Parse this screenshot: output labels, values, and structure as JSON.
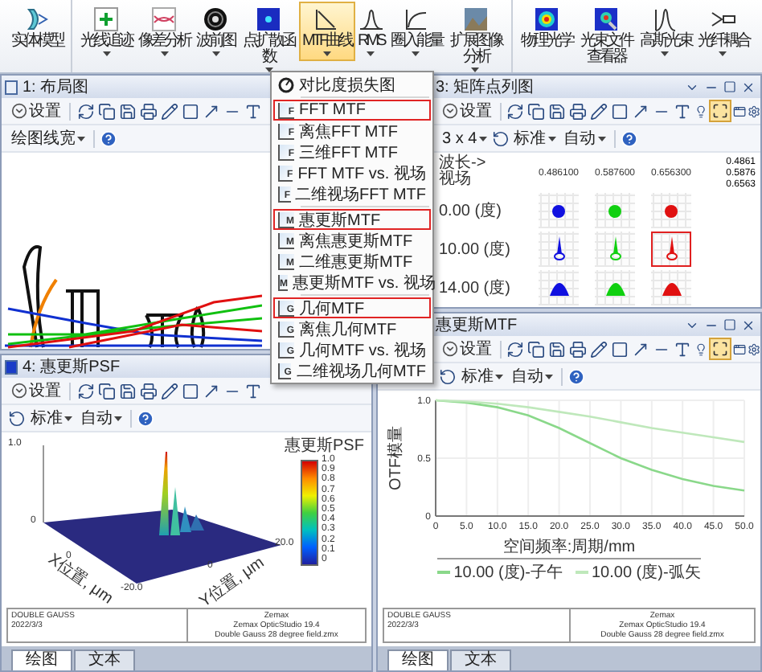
{
  "ribbon": {
    "groups": [
      [
        {
          "label": "实体模型",
          "dropdown": false,
          "selected": false
        }
      ],
      [
        {
          "label": "光线追迹",
          "dropdown": true,
          "selected": false
        },
        {
          "label": "像差分析",
          "dropdown": true,
          "selected": false
        },
        {
          "label": "波前图",
          "dropdown": true,
          "selected": false
        },
        {
          "label": "点扩散函数",
          "dropdown": true,
          "selected": false
        },
        {
          "label": "MTF曲线",
          "dropdown": true,
          "selected": true
        },
        {
          "label": "RMS",
          "dropdown": true,
          "selected": false
        },
        {
          "label": "圈入能量",
          "dropdown": true,
          "selected": false
        },
        {
          "label": "扩展图像分析",
          "dropdown": true,
          "selected": false
        }
      ],
      [
        {
          "label": "物理光学",
          "dropdown": false,
          "selected": false
        },
        {
          "label": "光束文件查看器",
          "dropdown": false,
          "selected": false
        },
        {
          "label": "高斯光束",
          "dropdown": true,
          "selected": false
        },
        {
          "label": "光纤耦合",
          "dropdown": true,
          "selected": false
        }
      ]
    ]
  },
  "left_column": [
    {
      "kind": "layout",
      "title": "1: 布局图",
      "settings": "设置",
      "dropdowns": [
        "绘图线宽"
      ]
    },
    {
      "kind": "psf",
      "title": "4: 惠更斯PSF",
      "settings": "设置",
      "dropdowns": [
        "标准",
        "自动"
      ],
      "plot": {
        "z_ticks": [
          "1.0",
          "0"
        ],
        "x_ticks": [
          "0",
          "-20.0"
        ],
        "y_ticks": [
          "0",
          "20.0"
        ],
        "xlabel": "X位置, μm",
        "ylabel": "Y位置, μm",
        "scale_title": "惠更斯PSF",
        "scale_ticks": [
          "1.0",
          "0.9",
          "0.8",
          "0.7",
          "0.6",
          "0.5",
          "0.4",
          "0.3",
          "0.2",
          "0.1",
          "0"
        ]
      },
      "footer": {
        "left": [
          "DOUBLE GAUSS",
          "2022/3/3"
        ],
        "right": [
          "Zemax",
          "Zemax OpticStudio 19.4",
          "Double Gauss 28 degree field.zmx"
        ]
      },
      "tabs": [
        {
          "label": "绘图",
          "selected": true
        },
        {
          "label": "文本",
          "selected": false
        }
      ]
    }
  ],
  "right_column": [
    {
      "kind": "spot",
      "title": "3: 矩阵点列图",
      "settings": "设置",
      "fit_active": true,
      "dropdowns": [
        "3 x 4",
        "标准",
        "自动"
      ],
      "spot": {
        "corner_top": "波长->",
        "corner_bottom": "视场",
        "wavelengths": [
          {
            "label": "0.486100",
            "legend": "0.4861",
            "color": "#1010e0"
          },
          {
            "label": "0.587600",
            "legend": "0.5876",
            "color": "#10d010"
          },
          {
            "label": "0.656300",
            "legend": "0.6563",
            "color": "#e01010"
          }
        ],
        "rows": [
          {
            "label": "0.00 (度)",
            "kind": "dot",
            "cells": [
              {
                "highlighted": false
              },
              {
                "highlighted": false
              },
              {
                "highlighted": false
              }
            ]
          },
          {
            "label": "10.00 (度)",
            "kind": "comet",
            "cells": [
              {
                "highlighted": false
              },
              {
                "highlighted": false
              },
              {
                "highlighted": true
              }
            ]
          },
          {
            "label": "14.00 (度)",
            "kind": "arc",
            "cells": [
              {
                "highlighted": false
              },
              {
                "highlighted": false
              },
              {
                "highlighted": false
              }
            ]
          }
        ]
      }
    },
    {
      "kind": "mtf",
      "title": "惠更斯MTF",
      "settings": "设置",
      "fit_active": true,
      "dropdowns": [
        "标准",
        "自动"
      ],
      "chart_data": {
        "type": "line",
        "xlabel": "空间频率:周期/mm",
        "ylabel": "OTF模量",
        "x": [
          0,
          5,
          10,
          15,
          20,
          25,
          30,
          35,
          40,
          45,
          50
        ],
        "series": [
          {
            "name": "10.00 (度)-子午",
            "color": "#8ad88a",
            "values": [
              1.0,
              0.98,
              0.94,
              0.87,
              0.76,
              0.63,
              0.5,
              0.4,
              0.32,
              0.26,
              0.22
            ]
          },
          {
            "name": "10.00 (度)-弧矢",
            "color": "#bfe8bb",
            "values": [
              1.0,
              0.99,
              0.97,
              0.94,
              0.9,
              0.86,
              0.81,
              0.76,
              0.72,
              0.68,
              0.64
            ]
          }
        ],
        "xlim": [
          0,
          50
        ],
        "ylim": [
          0,
          1
        ],
        "grid": true,
        "legend": true,
        "xticks": [
          {
            "value": 0,
            "label": "0"
          },
          {
            "value": 5,
            "label": "5.0"
          },
          {
            "value": 10,
            "label": "10.0"
          },
          {
            "value": 15,
            "label": "15.0"
          },
          {
            "value": 20,
            "label": "20.0"
          },
          {
            "value": 25,
            "label": "25.0"
          },
          {
            "value": 30,
            "label": "30.0"
          },
          {
            "value": 35,
            "label": "35.0"
          },
          {
            "value": 40,
            "label": "40.0"
          },
          {
            "value": 45,
            "label": "45.0"
          },
          {
            "value": 50,
            "label": "50.0"
          }
        ],
        "yticks": [
          {
            "value": 0,
            "label": "0"
          },
          {
            "value": 0.5,
            "label": "0.5"
          },
          {
            "value": 1,
            "label": "1.0"
          }
        ]
      },
      "footer": {
        "left": [
          "DOUBLE GAUSS",
          "2022/3/3"
        ],
        "right": [
          "Zemax",
          "Zemax OpticStudio 19.4",
          "Double Gauss 28 degree field.zmx"
        ]
      },
      "tabs": [
        {
          "label": "绘图",
          "selected": true
        },
        {
          "label": "文本",
          "selected": false
        }
      ]
    }
  ],
  "menu": {
    "groups": [
      [
        {
          "label": "对比度损失图",
          "kind": "contrast",
          "highlighted": false
        }
      ],
      [
        {
          "label": "FFT MTF",
          "kind": "mtf",
          "letter": "F",
          "highlighted": true
        },
        {
          "label": "离焦FFT MTF",
          "kind": "mtf",
          "letter": "F",
          "highlighted": false
        },
        {
          "label": "三维FFT MTF",
          "kind": "mtf",
          "letter": "F",
          "highlighted": false
        },
        {
          "label": "FFT MTF vs. 视场",
          "kind": "mtf",
          "letter": "F",
          "highlighted": false
        },
        {
          "label": "二维视场FFT MTF",
          "kind": "mtf",
          "letter": "F",
          "highlighted": false
        }
      ],
      [
        {
          "label": "惠更斯MTF",
          "kind": "mtf",
          "letter": "M",
          "highlighted": true
        },
        {
          "label": "离焦惠更斯MTF",
          "kind": "mtf",
          "letter": "M",
          "highlighted": false
        },
        {
          "label": "二维惠更斯MTF",
          "kind": "mtf",
          "letter": "M",
          "highlighted": false
        },
        {
          "label": "惠更斯MTF vs. 视场",
          "kind": "mtf",
          "letter": "M",
          "highlighted": false
        }
      ],
      [
        {
          "label": "几何MTF",
          "kind": "mtf",
          "letter": "G",
          "highlighted": true
        },
        {
          "label": "离焦几何MTF",
          "kind": "mtf",
          "letter": "G",
          "highlighted": false
        },
        {
          "label": "几何MTF vs. 视场",
          "kind": "mtf",
          "letter": "G",
          "highlighted": false
        },
        {
          "label": "二维视场几何MTF",
          "kind": "mtf",
          "letter": "G",
          "highlighted": false
        }
      ]
    ]
  }
}
